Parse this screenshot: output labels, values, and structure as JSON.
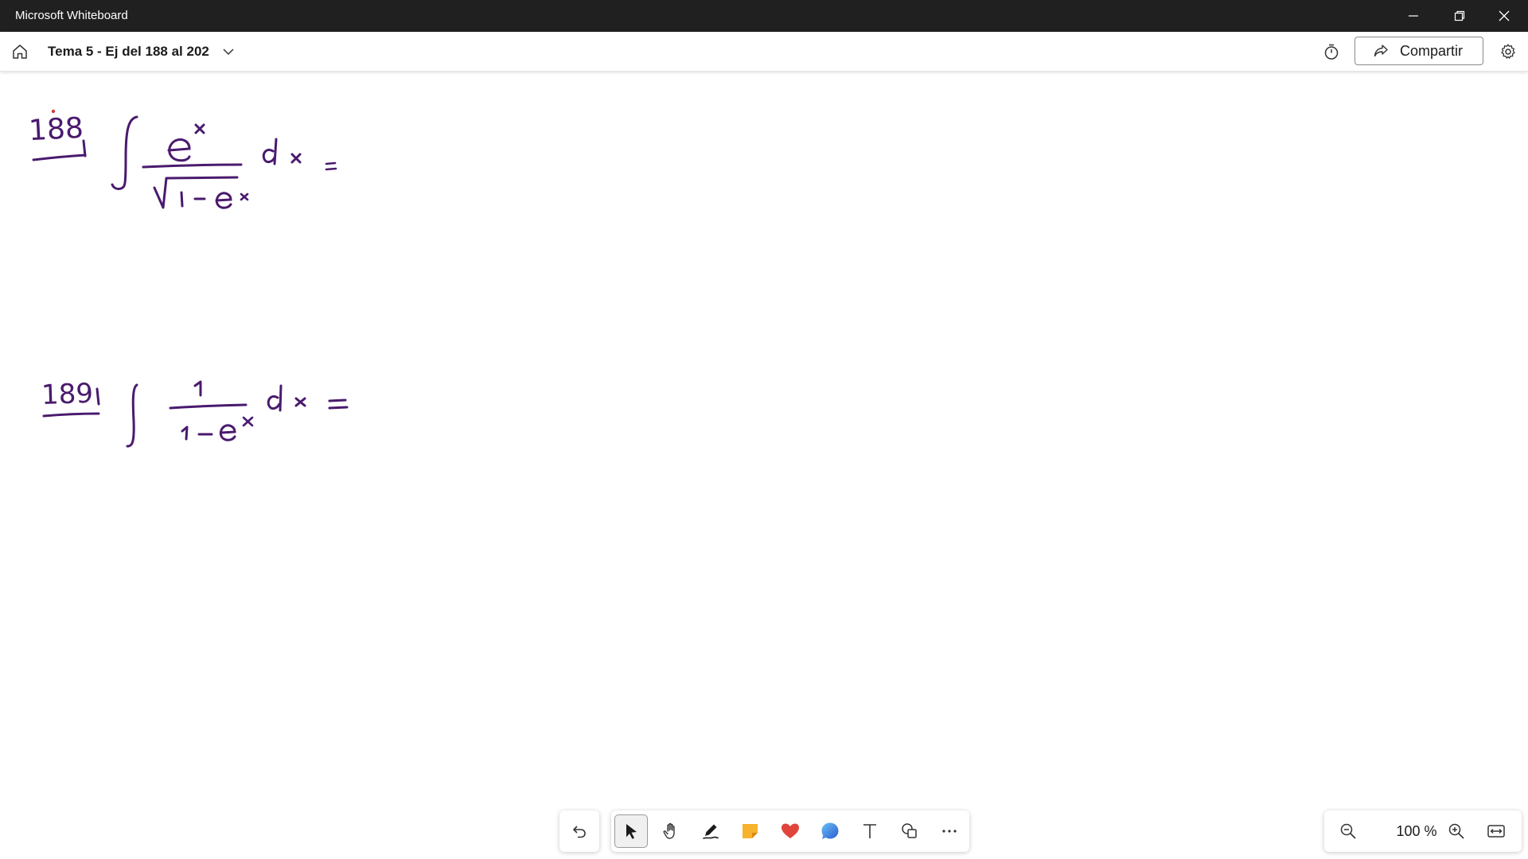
{
  "window": {
    "app_title": "Microsoft Whiteboard"
  },
  "header": {
    "board_title": "Tema 5 - Ej del 188 al 202",
    "share_label": "Compartir"
  },
  "canvas": {
    "ink_color": "#4a1a6e",
    "problem_1_number": "188",
    "problem_2_number": "189"
  },
  "toolbar": {
    "tools": [
      "undo-icon",
      "select-icon",
      "pan-hand-icon",
      "pen-icon",
      "sticky-note-icon",
      "reactions-heart-icon",
      "shapes-bubble-icon",
      "text-icon",
      "shapes-icon",
      "more-icon"
    ],
    "active_tool": "select-icon"
  },
  "zoom": {
    "level": "100 %"
  },
  "colors": {
    "titlebar": "#202020",
    "sticky_note": "#f7b32b",
    "heart": "#e0443a",
    "bubble": "#3a86d8"
  }
}
